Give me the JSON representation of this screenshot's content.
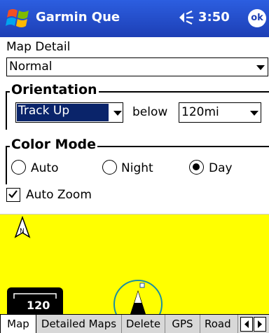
{
  "titlebar": {
    "app_title": "Garmin Que",
    "clock": "3:50",
    "ok_label": "ok",
    "start_icon": "windows-flag-icon",
    "volume_icon": "speaker-volume-icon"
  },
  "map_detail": {
    "label": "Map Detail",
    "value": "Normal"
  },
  "orientation": {
    "title": "Orientation",
    "value": "Track Up",
    "below_label": "below",
    "distance": "120mi"
  },
  "color_mode": {
    "title": "Color Mode",
    "options": [
      "Auto",
      "Night",
      "Day"
    ],
    "selected": "Day"
  },
  "auto_zoom": {
    "label": "Auto Zoom",
    "checked": true
  },
  "map_preview": {
    "scale": "120",
    "background": "#ffff00"
  },
  "tabs": [
    "Map",
    "Detailed Maps",
    "Delete",
    "GPS",
    "Road"
  ],
  "active_tab": "Map",
  "colors": {
    "titlebar": "#1d3fb5",
    "selection": "#0a246a",
    "map": "#ffff00"
  }
}
